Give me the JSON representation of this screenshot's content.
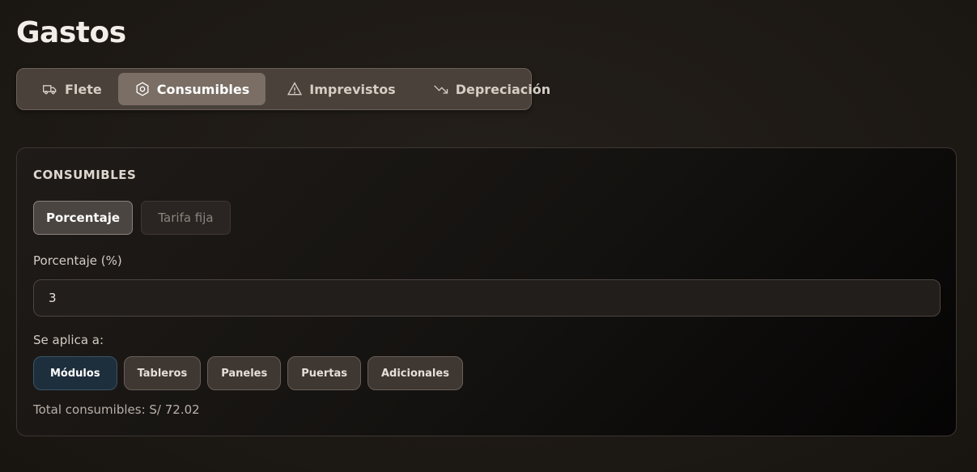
{
  "page": {
    "title": "Gastos"
  },
  "tabs": [
    {
      "label": "Flete",
      "icon": "truck-icon",
      "active": false
    },
    {
      "label": "Consumibles",
      "icon": "hexagon-nut-icon",
      "active": true
    },
    {
      "label": "Imprevistos",
      "icon": "warning-triangle-icon",
      "active": false
    },
    {
      "label": "Depreciación",
      "icon": "trending-down-icon",
      "active": false
    }
  ],
  "section": {
    "title": "CONSUMIBLES",
    "modes": {
      "percentage": "Porcentaje",
      "fixed": "Tarifa fija"
    },
    "field_label": "Porcentaje (%)",
    "field_value": "3",
    "apply_label": "Se aplica a:",
    "chips": [
      "Módulos",
      "Tableros",
      "Paneles",
      "Puertas",
      "Adicionales"
    ],
    "total": "Total consumibles: S/ 72.02"
  },
  "colors": {
    "accent_selected": "#1d2e3d",
    "tab_active": "#7a6e65"
  }
}
